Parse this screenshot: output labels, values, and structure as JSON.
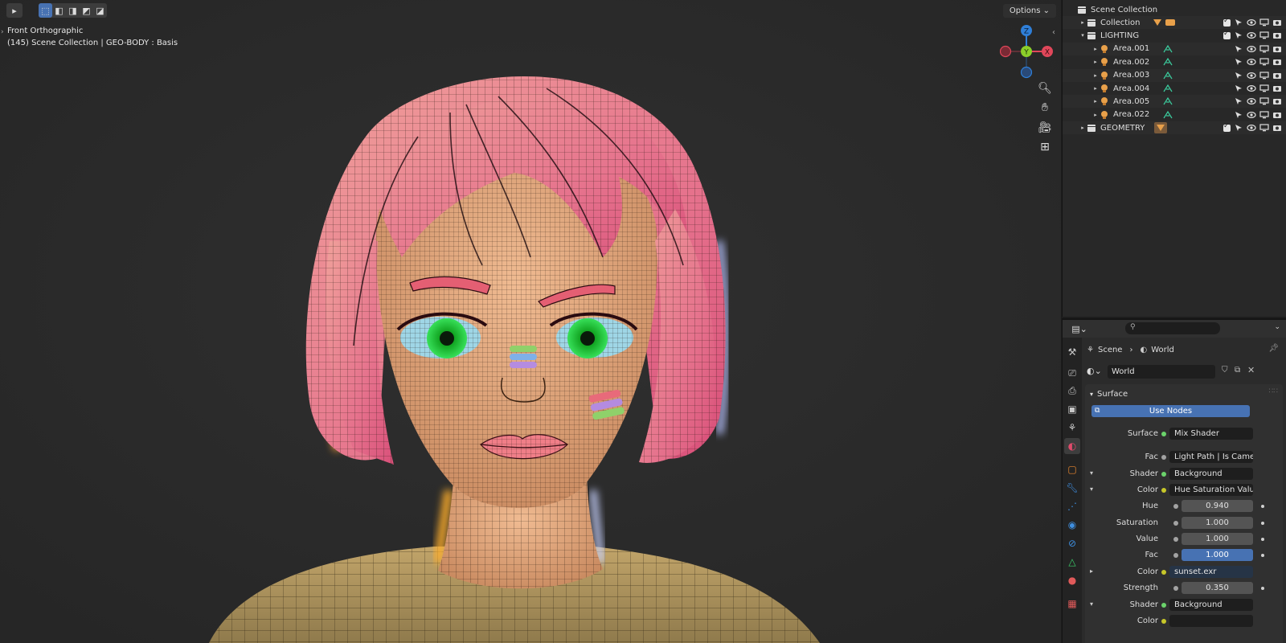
{
  "viewport": {
    "view_name": "Front Orthographic",
    "context": "(145) Scene Collection | GEO-BODY : Basis",
    "options_label": "Options ⌄",
    "gizmo": {
      "z": "Z",
      "y": "Y",
      "x": "X"
    }
  },
  "outliner": {
    "root": "Scene Collection",
    "rows": [
      {
        "label": "Collection",
        "level": 1,
        "expanded": false,
        "type": "collection"
      },
      {
        "label": "LIGHTING",
        "level": 1,
        "expanded": true,
        "type": "collection"
      },
      {
        "label": "Area.001",
        "level": 2,
        "expanded": false,
        "type": "light"
      },
      {
        "label": "Area.002",
        "level": 2,
        "expanded": false,
        "type": "light"
      },
      {
        "label": "Area.003",
        "level": 2,
        "expanded": false,
        "type": "light"
      },
      {
        "label": "Area.004",
        "level": 2,
        "expanded": false,
        "type": "light"
      },
      {
        "label": "Area.005",
        "level": 2,
        "expanded": false,
        "type": "light"
      },
      {
        "label": "Area.022",
        "level": 2,
        "expanded": false,
        "type": "light"
      },
      {
        "label": "GEOMETRY",
        "level": 1,
        "expanded": false,
        "type": "collection"
      }
    ]
  },
  "properties": {
    "breadcrumb": {
      "scene": "Scene",
      "world": "World"
    },
    "world_name": "World",
    "panel_title": "Surface",
    "use_nodes": "Use Nodes",
    "rows": [
      {
        "label": "Surface",
        "value": "Mix Shader",
        "socket": "#6bd36b",
        "kind": "link",
        "expander": ""
      },
      {
        "label": "Fac",
        "value": "Light Path | Is Came...",
        "socket": "#a3a3a3",
        "kind": "link",
        "expander": ""
      },
      {
        "label": "Shader",
        "value": "Background",
        "socket": "#6bd36b",
        "kind": "link",
        "expander": "▾"
      },
      {
        "label": "Color",
        "value": "Hue Saturation Value",
        "socket": "#c7c729",
        "kind": "link",
        "expander": "▾"
      },
      {
        "label": "Hue",
        "value": "0.940",
        "socket": "#a3a3a3",
        "kind": "num",
        "expander": ""
      },
      {
        "label": "Saturation",
        "value": "1.000",
        "socket": "#a3a3a3",
        "kind": "num",
        "expander": ""
      },
      {
        "label": "Value",
        "value": "1.000",
        "socket": "#a3a3a3",
        "kind": "num",
        "expander": ""
      },
      {
        "label": "Fac",
        "value": "1.000",
        "socket": "#a3a3a3",
        "kind": "num-blue",
        "expander": ""
      },
      {
        "label": "Color",
        "value": "sunset.exr",
        "socket": "#c7c729",
        "kind": "img",
        "expander": "▸"
      },
      {
        "label": "Strength",
        "value": "0.350",
        "socket": "#a3a3a3",
        "kind": "num",
        "expander": ""
      },
      {
        "label": "Shader",
        "value": "Background",
        "socket": "#6bd36b",
        "kind": "link",
        "expander": "▾"
      },
      {
        "label": "Color",
        "value": "",
        "socket": "#c7c729",
        "kind": "link",
        "expander": ""
      }
    ]
  },
  "colors": {
    "accent": "#4772b3",
    "axis_x": "#e0475a",
    "axis_y": "#8bcf2a",
    "axis_z": "#2f7fd8",
    "hair": "#e7778a",
    "skin": "#e0a77d",
    "eyes": "#1fc23a"
  }
}
